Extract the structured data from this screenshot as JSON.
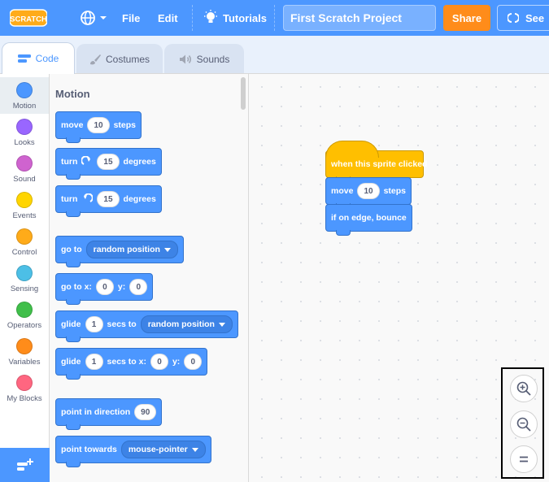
{
  "menubar": {
    "logo_text": "SCRATCH",
    "file_label": "File",
    "edit_label": "Edit",
    "tutorials_label": "Tutorials",
    "project_title": "First Scratch Project",
    "share_label": "Share",
    "see_project_label": "See",
    "language_icon": "globe-icon"
  },
  "tabs": [
    {
      "label": "Code",
      "icon": "code-icon",
      "active": true
    },
    {
      "label": "Costumes",
      "icon": "brush-icon",
      "active": false
    },
    {
      "label": "Sounds",
      "icon": "speaker-icon",
      "active": false
    }
  ],
  "categories": [
    {
      "label": "Motion",
      "color": "#4c97ff",
      "selected": true
    },
    {
      "label": "Looks",
      "color": "#9966ff"
    },
    {
      "label": "Sound",
      "color": "#cf63cf"
    },
    {
      "label": "Events",
      "color": "#ffd500"
    },
    {
      "label": "Control",
      "color": "#ffab19"
    },
    {
      "label": "Sensing",
      "color": "#4cbfe6"
    },
    {
      "label": "Operators",
      "color": "#40bf4a"
    },
    {
      "label": "Variables",
      "color": "#ff8c1a"
    },
    {
      "label": "My Blocks",
      "color": "#ff6680"
    }
  ],
  "palette": {
    "heading": "Motion",
    "blocks": {
      "move": {
        "label": "move",
        "value": "10",
        "suffix": "steps"
      },
      "turn_right": {
        "label": "turn",
        "value": "15",
        "suffix": "degrees"
      },
      "turn_left": {
        "label": "turn",
        "value": "15",
        "suffix": "degrees"
      },
      "go_to": {
        "label": "go to",
        "option": "random position"
      },
      "go_to_xy": {
        "label": "go to x:",
        "x": "0",
        "y_label": "y:",
        "y": "0"
      },
      "glide_to": {
        "label": "glide",
        "secs": "1",
        "mid": "secs to",
        "option": "random position"
      },
      "glide_xy": {
        "label": "glide",
        "secs": "1",
        "mid": "secs to x:",
        "x": "0",
        "y_label": "y:",
        "y": "0"
      },
      "point_direction": {
        "label": "point in direction",
        "value": "90"
      },
      "point_towards": {
        "label": "point towards",
        "option": "mouse-pointer"
      }
    }
  },
  "script": {
    "hat_label": "when this sprite clicked",
    "move_label": "move",
    "move_value": "10",
    "move_suffix": "steps",
    "bounce_label": "if on edge, bounce"
  },
  "zoom": {
    "zoom_in_icon": "zoom-in-icon",
    "zoom_out_icon": "zoom-out-icon",
    "reset_icon": "zoom-reset-icon"
  }
}
